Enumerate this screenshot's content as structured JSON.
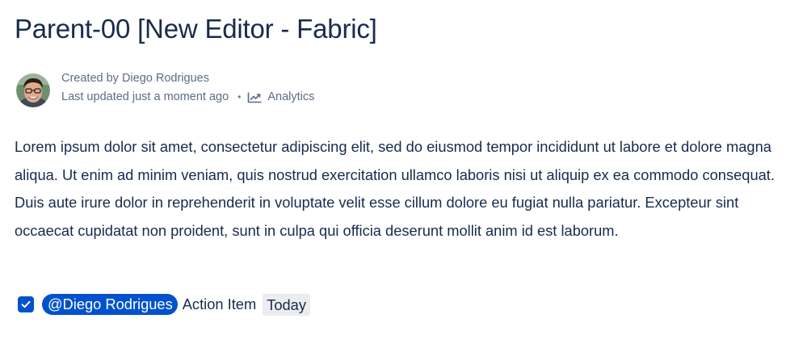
{
  "page": {
    "title": "Parent-00 [New Editor - Fabric]"
  },
  "byline": {
    "created_by": "Created by Diego Rodrigues",
    "last_updated": "Last updated just a moment ago",
    "separator": "•",
    "analytics_label": "Analytics",
    "analytics_icon": "line-chart-icon"
  },
  "content": {
    "paragraph": "Lorem ipsum dolor sit amet, consectetur adipiscing elit, sed do eiusmod tempor incididunt ut labore et dolore magna aliqua. Ut enim ad minim veniam, quis nostrud exercitation ullamco laboris nisi ut aliquip ex ea commodo consequat. Duis aute irure dolor in reprehenderit in voluptate velit esse cillum dolore eu fugiat nulla pariatur. Excepteur sint occaecat cupidatat non proident, sunt in culpa qui officia deserunt mollit anim id est laborum."
  },
  "action_item": {
    "checked": true,
    "mention": "@Diego Rodrigues",
    "text": "Action Item",
    "date": "Today"
  },
  "colors": {
    "title_text": "#172b4d",
    "meta_text": "#5e6c84",
    "accent": "#0052cc",
    "lozenge_bg": "#ebecf0"
  }
}
